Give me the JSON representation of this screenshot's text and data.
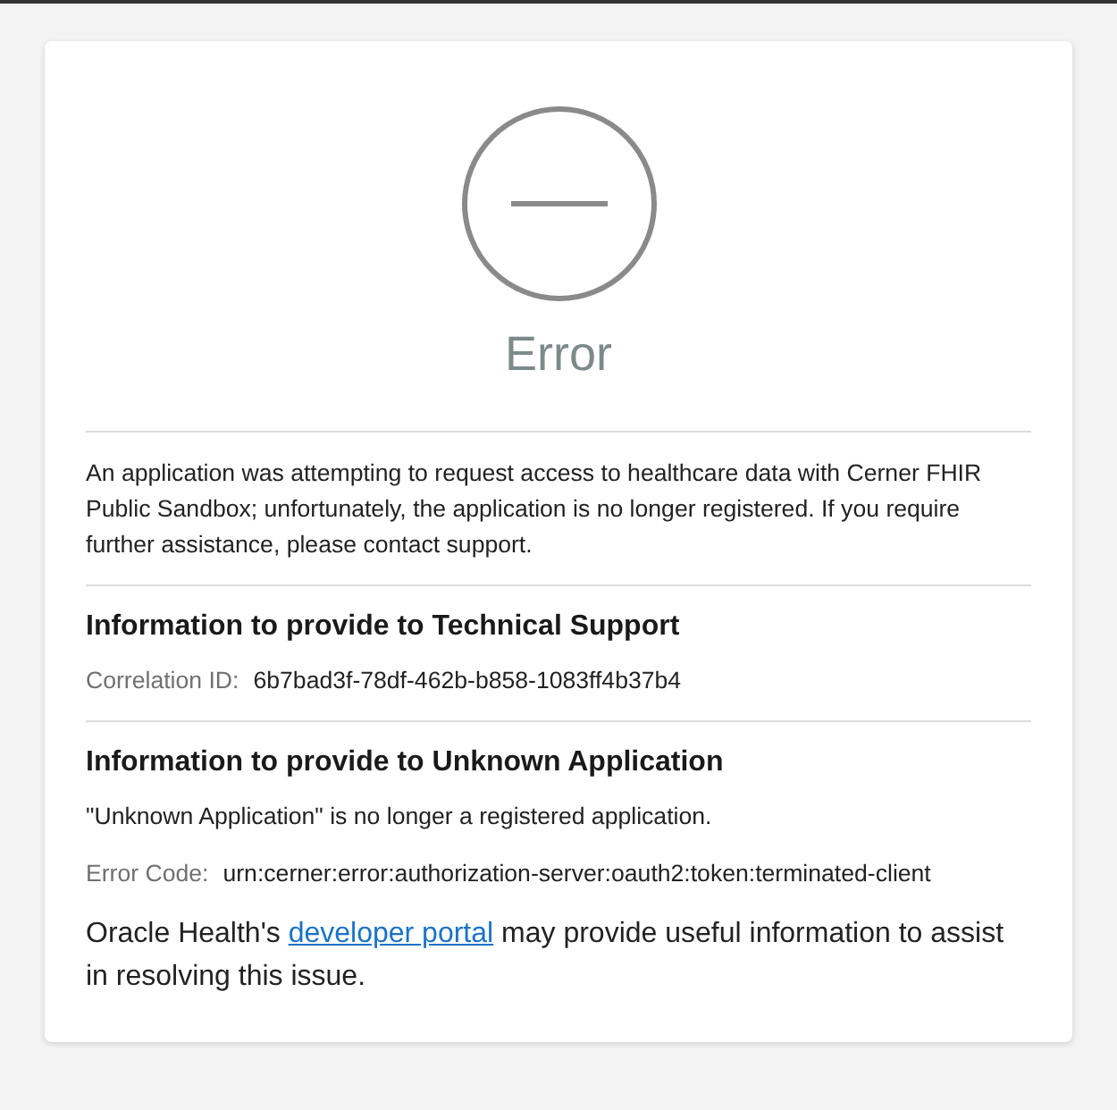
{
  "title": "Error",
  "message": "An application was attempting to request access to healthcare data with Cerner FHIR Public Sandbox; unfortunately, the application is no longer registered. If you require further assistance, please contact support.",
  "sections": [
    {
      "heading": "Information to provide to Technical Support",
      "items": [
        {
          "kind": "field",
          "label": "Correlation ID:",
          "value": "6b7bad3f-78df-462b-b858-1083ff4b37b4"
        }
      ]
    },
    {
      "heading": "Information to provide to Unknown Application",
      "items": [
        {
          "kind": "note",
          "text": "\"Unknown Application\" is no longer a registered application."
        },
        {
          "kind": "field",
          "label": "Error Code:",
          "value": "urn:cerner:error:authorization-server:oauth2:token:terminated-client"
        }
      ]
    }
  ],
  "footer": {
    "before": "Oracle Health's ",
    "link": "developer portal",
    "after": " may provide useful information to assist in resolving this issue."
  }
}
